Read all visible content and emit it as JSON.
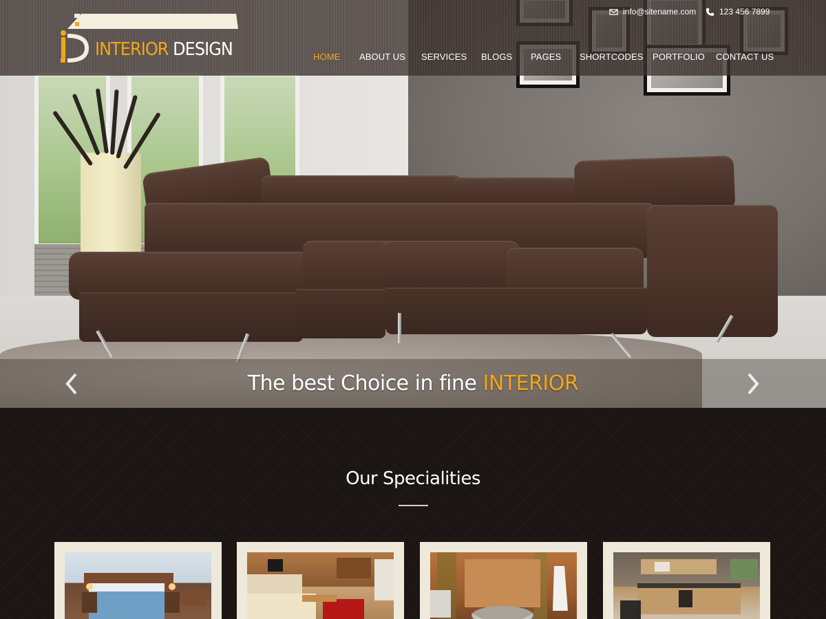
{
  "brand": {
    "name_part1": "INTERIOR",
    "name_part2": "DESIGN"
  },
  "contact": {
    "email": "info@sitename.com",
    "phone": "123 456 7899"
  },
  "nav": {
    "items": [
      {
        "label": "HOME",
        "active": true
      },
      {
        "label": "ABOUT US"
      },
      {
        "label": "SERVICES"
      },
      {
        "label": "BLOGS"
      },
      {
        "label": "PAGES"
      },
      {
        "label": "SHORTCODES"
      },
      {
        "label": "PORTFOLIO"
      },
      {
        "label": "CONTACT US"
      }
    ]
  },
  "hero": {
    "caption_main": "The best Choice in fine",
    "caption_accent": "INTERIOR",
    "prev_icon": "chevron-left-icon",
    "next_icon": "chevron-right-icon"
  },
  "specialities": {
    "title": "Our Specialities",
    "cards": [
      {
        "image": "bedroom"
      },
      {
        "image": "living-room"
      },
      {
        "image": "bathroom"
      },
      {
        "image": "kitchen"
      }
    ]
  },
  "colors": {
    "accent": "#f2a71b",
    "header_bg": "#3a302c",
    "section_bg": "#1b1614",
    "card_frame": "#efe9dc"
  }
}
